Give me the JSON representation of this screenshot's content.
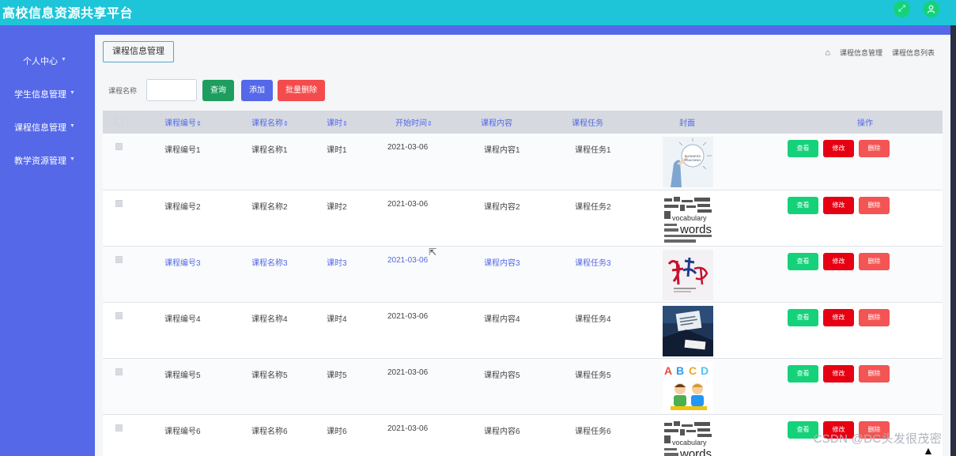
{
  "app": {
    "title": "高校信息资源共享平台",
    "icons": [
      "fullscreen-icon",
      "user-icon"
    ]
  },
  "sidebar": {
    "items": [
      {
        "label": "个人中心"
      },
      {
        "label": "学生信息管理"
      },
      {
        "label": "课程信息管理"
      },
      {
        "label": "教学资源管理"
      }
    ]
  },
  "page": {
    "title": "课程信息管理",
    "breadcrumb": [
      "课程信息管理",
      "课程信息列表"
    ]
  },
  "search": {
    "label": "课程名称",
    "value": "",
    "query_label": "查询",
    "add_label": "添加",
    "batch_delete_label": "批量删除"
  },
  "table": {
    "headers": [
      "课程编号",
      "课程名称",
      "课时",
      "开始时间",
      "课程内容",
      "课程任务",
      "封面",
      "操作"
    ],
    "sortable": [
      true,
      true,
      true,
      true,
      false,
      false,
      false,
      false
    ],
    "actions": {
      "view": "查看",
      "edit": "修改",
      "delete": "删除"
    },
    "rows": [
      {
        "code": "课程编号1",
        "name": "课程名称1",
        "hours": "课时1",
        "start": "2021-03-06",
        "content": "课程内容1",
        "task": "课程任务1",
        "cover": "business-teaching"
      },
      {
        "code": "课程编号2",
        "name": "课程名称2",
        "hours": "课时2",
        "start": "2021-03-06",
        "content": "课程内容2",
        "task": "课程任务2",
        "cover": "vocabulary-words"
      },
      {
        "code": "课程编号3",
        "name": "课程名称3",
        "hours": "课时3",
        "start": "2021-03-06",
        "content": "课程内容3",
        "task": "课程任务3",
        "cover": "jiancao-calligraphy"
      },
      {
        "code": "课程编号4",
        "name": "课程名称4",
        "hours": "课时4",
        "start": "2021-03-06",
        "content": "课程内容4",
        "task": "课程任务4",
        "cover": "business-desk"
      },
      {
        "code": "课程编号5",
        "name": "课程名称5",
        "hours": "课时5",
        "start": "2021-03-06",
        "content": "课程内容5",
        "task": "课程任务5",
        "cover": "abcd-kids"
      },
      {
        "code": "课程编号6",
        "name": "课程名称6",
        "hours": "课时6",
        "start": "2021-03-06",
        "content": "课程内容6",
        "task": "课程任务6",
        "cover": "vocabulary-words"
      }
    ],
    "highlighted_row": 2
  },
  "watermark": "CSDN @DC头发很茂密",
  "colors": {
    "topbar": "#1ec5d8",
    "sidebar": "#5468e8",
    "view": "#15d27a",
    "edit": "#e60012",
    "delete": "#f35454",
    "query": "#1d9e5f",
    "batch": "#f44c4c"
  }
}
